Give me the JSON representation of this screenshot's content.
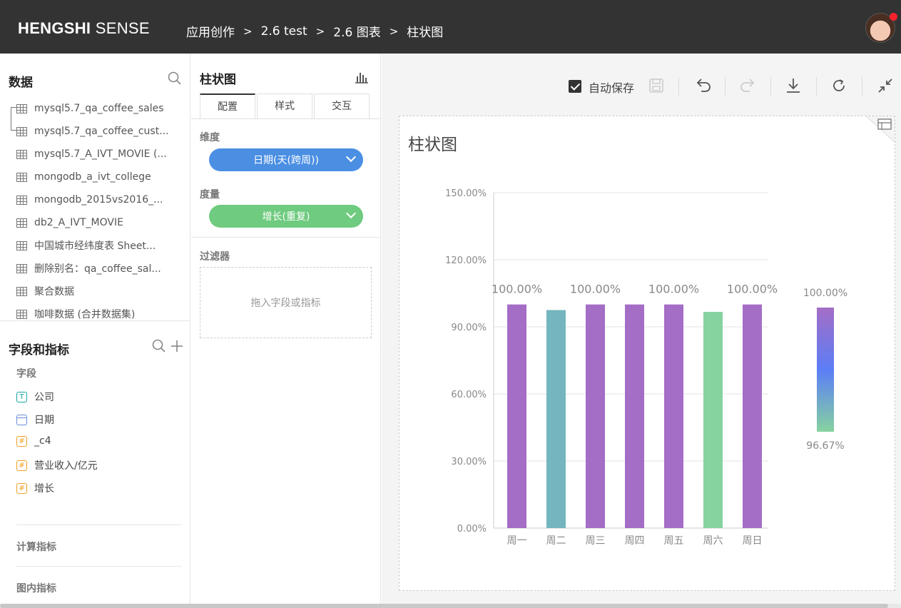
{
  "header": {
    "brand_bold": "HENGSHI",
    "brand_light": "SENSE",
    "breadcrumb": [
      "应用创作",
      "2.6 test",
      "2.6 图表",
      "柱状图"
    ],
    "breadcrumb_sep": ">"
  },
  "data_panel": {
    "title": "数据",
    "datasets": [
      "mysql5.7_qa_coffee_sales",
      "mysql5.7_qa_coffee_cust...",
      "mysql5.7_A_IVT_MOVIE (...",
      "mongodb_a_ivt_college",
      "mongodb_2015vs2016_...",
      "db2_A_IVT_MOVIE",
      "中国城市经纬度表 Sheet...",
      "删除别名：qa_coffee_sal...",
      "聚合数据",
      "咖啡数据 (合并数据集)"
    ]
  },
  "fields_panel": {
    "title": "字段和指标",
    "fields_label": "字段",
    "fields": [
      {
        "type": "T",
        "name": "公司"
      },
      {
        "type": "D",
        "name": "日期"
      },
      {
        "type": "#",
        "name": "_c4"
      },
      {
        "type": "#",
        "name": "营业收入/亿元"
      },
      {
        "type": "#",
        "name": "增长"
      }
    ],
    "calc_label": "计算指标",
    "chart_label": "图内指标"
  },
  "config_panel": {
    "title": "柱状图",
    "tabs": [
      "配置",
      "样式",
      "交互"
    ],
    "dimension_label": "维度",
    "dimension_value": "日期(天(跨周))",
    "measure_label": "度量",
    "measure_value": "增长(重复)",
    "filter_label": "过滤器",
    "filter_placeholder": "拖入字段或指标",
    "colors": {
      "dimension": "#4b8fe3",
      "measure": "#6fcb7f"
    }
  },
  "toolbar": {
    "autosave_label": "自动保存",
    "autosave_checked": true
  },
  "chart_data": {
    "type": "bar",
    "title": "柱状图",
    "categories": [
      "周一",
      "周二",
      "周三",
      "周四",
      "周五",
      "周六",
      "周日"
    ],
    "values": [
      100.0,
      97.5,
      100.0,
      100.0,
      100.0,
      96.67,
      100.0
    ],
    "data_labels": [
      "100.00%",
      "",
      "100.00%",
      "",
      "100.00%",
      "",
      "100.00%"
    ],
    "bar_colors": [
      "#a46dc6",
      "#74b5bf",
      "#a46dc6",
      "#a46dc6",
      "#a46dc6",
      "#86d3a0",
      "#a46dc6"
    ],
    "yticks": [
      "0.00%",
      "30.00%",
      "60.00%",
      "90.00%",
      "120.00%",
      "150.00%"
    ],
    "ylim": [
      0,
      150
    ],
    "grid": true,
    "legend": {
      "type": "color-gradient",
      "placement": "right",
      "max_label": "100.00%",
      "min_label": "96.67%",
      "colors": [
        "#a46dc6",
        "#5b7ef6",
        "#86d3a0"
      ]
    }
  }
}
